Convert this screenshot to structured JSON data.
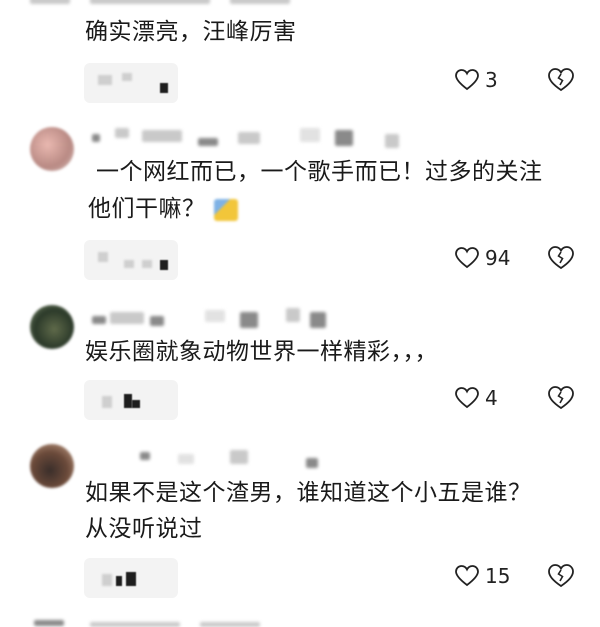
{
  "comments": [
    {
      "text_lines": [
        "确实漂亮，汪峰厉害"
      ],
      "likes": "3"
    },
    {
      "text_lines": [
        "一个网红而已，一个歌手而已！过多的关注",
        "他们干嘛？"
      ],
      "likes": "94"
    },
    {
      "text_lines": [
        "娱乐圈就象动物世界一样精彩，，，"
      ],
      "likes": "4"
    },
    {
      "text_lines": [
        "如果不是这个渣男，谁知道这个小五是谁？",
        "从没听说过"
      ],
      "likes": "15"
    }
  ],
  "icons": {
    "like": "heart-outline-icon",
    "dislike": "broken-heart-icon"
  }
}
